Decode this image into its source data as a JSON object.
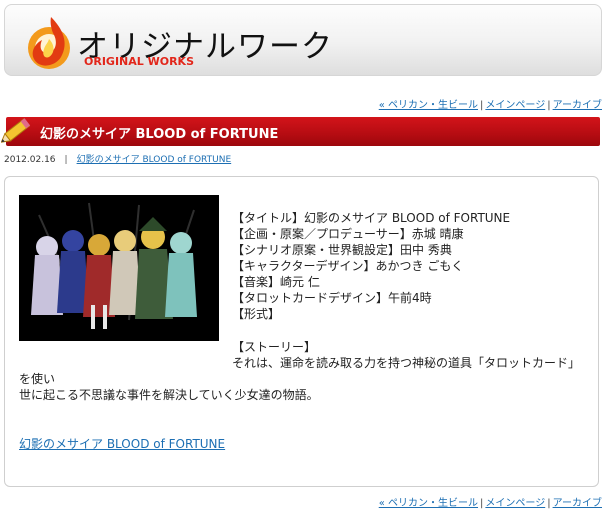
{
  "header": {
    "title": "オリジナルワーク",
    "subtitle": "ORIGINAL WORKS"
  },
  "nav": {
    "prev": "« ペリカン・生ビール",
    "main": "メインページ",
    "archive": "アーカイブ",
    "separator": "|"
  },
  "post": {
    "title": "幻影のメサイア BLOOD of FORTUNE",
    "date": "2012.02.16",
    "meta_separator": "|",
    "meta_link": "幻影のメサイア BLOOD of FORTUNE"
  },
  "info": {
    "lines": [
      "【タイトル】幻影のメサイア BLOOD of FORTUNE",
      "【企画・原案／プロデューサー】赤城 晴康",
      "【シナリオ原案・世界観設定】田中 秀典",
      "【キャラクターデザイン】あかつき ごもく",
      "【音楽】崎元 仁",
      "【タロットカードデザイン】午前4時",
      "【形式】"
    ],
    "story_label": "【ストーリー】",
    "story_line1": "それは、運命を読み取る力を持つ神秘の道具「タロットカード」を使い",
    "story_line2": "世に起こる不思議な事件を解決していく少女達の物語。"
  },
  "bottom_link": "幻影のメサイア BLOOD of FORTUNE",
  "colors": {
    "title_bar": "#c10f15",
    "subtitle_red": "#e2261a",
    "link_blue": "#1d6fb3"
  },
  "icons": {
    "logo": "flame-logo-icon",
    "pencil": "pencil-icon"
  }
}
